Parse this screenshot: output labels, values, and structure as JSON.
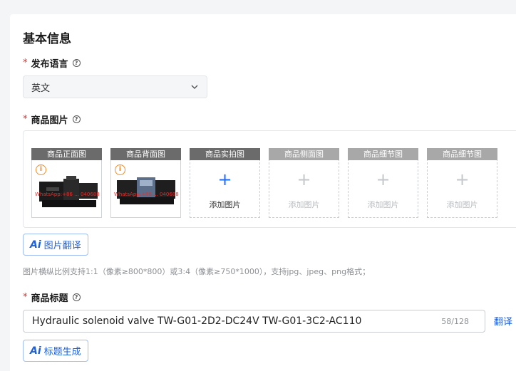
{
  "section": {
    "title": "基本信息"
  },
  "language": {
    "label": "发布语言",
    "required": "*",
    "help": "?",
    "value": "英文"
  },
  "images": {
    "label": "商品图片",
    "required": "*",
    "help": "?",
    "slots": [
      {
        "title": "商品正面图",
        "state": "filled",
        "watermark": "WhatsApp:+86 ... 040688"
      },
      {
        "title": "商品背面图",
        "state": "filled",
        "watermark": "WhatsApp:+86 ... 040688"
      },
      {
        "title": "商品实拍图",
        "state": "active",
        "add_label": "添加图片"
      },
      {
        "title": "商品侧面图",
        "state": "inactive",
        "add_label": "添加图片"
      },
      {
        "title": "商品细节图",
        "state": "inactive",
        "add_label": "添加图片"
      },
      {
        "title": "商品细节图",
        "state": "inactive",
        "add_label": "添加图片"
      }
    ],
    "translate_button": {
      "badge": "Ai",
      "label": "图片翻译"
    },
    "hint": "图片横纵比例支持1:1（像素≥800*800）或3:4（像素≥750*1000），支持jpg、jpeg、png格式；"
  },
  "product_title": {
    "label": "商品标题",
    "required": "*",
    "help": "?",
    "value": "Hydraulic solenoid valve TW-G01-2D2-DC24V TW-G01-3C2-AC110",
    "counter": "58/128",
    "translate_link": "翻译",
    "generate_button": {
      "badge": "Ai",
      "label": "标题生成"
    }
  },
  "colors": {
    "accent": "#1f5fd6",
    "required": "#e5312f",
    "warning": "#f08a24"
  }
}
